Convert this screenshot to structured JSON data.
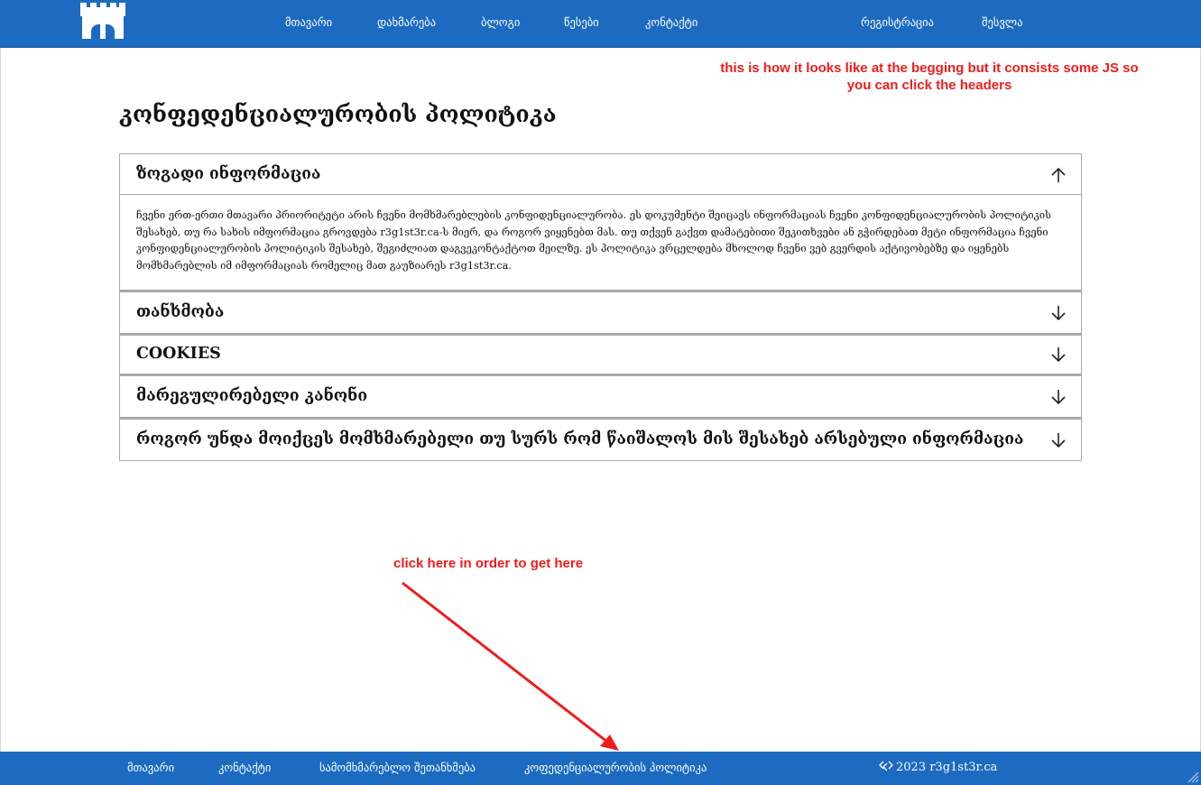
{
  "header": {
    "logo_icon": "bridge-logo-icon",
    "nav": [
      {
        "label": "მთავარი"
      },
      {
        "label": "დახმარება"
      },
      {
        "label": "ბლოგი"
      },
      {
        "label": "წესები"
      },
      {
        "label": "კონტაქტი"
      }
    ],
    "auth": {
      "register": "რეგისტრაცია",
      "login": "შესვლა"
    }
  },
  "annotations": {
    "top_note_line1": "this is how it looks like at the begging but it consists some JS so",
    "top_note_line2": "you can click the headers",
    "bottom_note": "click here in order to get here",
    "color": "#ee1c1c"
  },
  "page_title": "კონფედენციალურობის პოლიტიკა",
  "accordion": [
    {
      "title": "ზოგადი ინფორმაცია",
      "expanded": true,
      "arrow_icon": "arrow-up-icon",
      "body": "ჩვენი ერთ-ერთი მთავარი პრიორიტეტი არის ჩვენი მომხმარებლების კონფიდენციალურობა. ეს დოკუმენტი შეიცავს ინფორმაციას ჩვენი კონფიდენციალურობის პოლიტიკის შესახებ, თუ რა სახის იმფორმაცია გროვდება r3g1st3r.ca-ს მიერ, და როგორ ვიყენებთ მას. თუ თქვენ გაქვთ დამატებითი შეკითხვები ან გჭირდებათ მეტი ინფორმაცია ჩვენი კონფიდენციალურობის პოლიტიკის შესახებ, შეგიძლიათ დაგვეკონტაქტოთ მეილზე. ეს პოლიტიკა ვრცელდება მხოლოდ ჩვენი ვებ გვერდის აქტივობებზე და იყენებს მომხმარებლის იმ იმფორმაციას რომელიც მათ გაუზიარეს r3g1st3r.ca."
    },
    {
      "title": "თანხმობა",
      "expanded": false,
      "arrow_icon": "arrow-down-icon"
    },
    {
      "title": "COOKIES",
      "expanded": false,
      "arrow_icon": "arrow-down-icon"
    },
    {
      "title": "მარეგულირებელი კანონი",
      "expanded": false,
      "arrow_icon": "arrow-down-icon"
    },
    {
      "title": "როგორ უნდა მოიქცეს მომხმარებელი თუ სურს რომ წაიშალოს მის შესახებ არსებული ინფორმაცია",
      "expanded": false,
      "arrow_icon": "arrow-down-icon"
    }
  ],
  "footer": {
    "links": [
      {
        "label": "მთავარი"
      },
      {
        "label": "კონტაქტი"
      },
      {
        "label": "სამომხმარებლო შეთანხმება"
      },
      {
        "label": "კოფედენციალურობის პოლიტიკა"
      }
    ],
    "copyright": "2023 r3g1st3r.ca",
    "copyright_icon": "copyright-diamond-icon"
  },
  "colors": {
    "brand_blue": "#1c6bc0",
    "border_gray": "#a9a9a9"
  }
}
